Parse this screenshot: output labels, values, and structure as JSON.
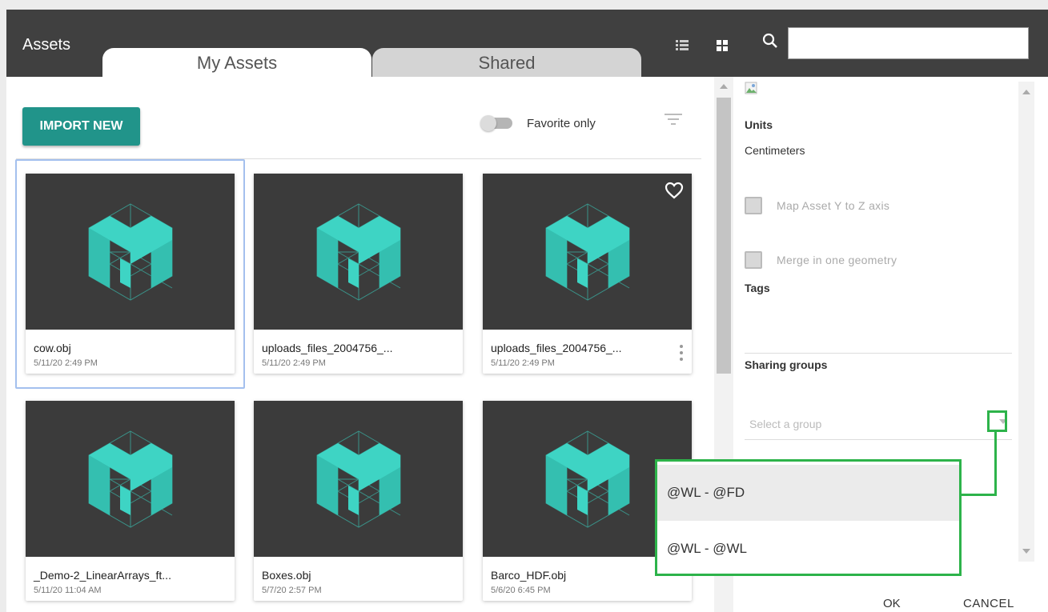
{
  "header": {
    "title": "Assets",
    "tabs": [
      {
        "label": "My Assets",
        "active": true
      },
      {
        "label": "Shared",
        "active": false
      }
    ],
    "list_view_icon": "list-icon",
    "grid_view_icon": "grid-icon",
    "search_icon": "search-icon",
    "search_value": ""
  },
  "toolbar": {
    "import_label": "IMPORT NEW",
    "favorite_label": "Favorite only",
    "filter_icon": "filter-icon"
  },
  "assets": [
    {
      "name": "cow.obj",
      "date": "5/11/20 2:49 PM",
      "selected": true,
      "favorite": false,
      "menu": false
    },
    {
      "name": "uploads_files_2004756_...",
      "date": "5/11/20 2:49 PM",
      "selected": false,
      "favorite": false,
      "menu": false
    },
    {
      "name": "uploads_files_2004756_...",
      "date": "5/11/20 2:49 PM",
      "selected": false,
      "favorite": true,
      "menu": true
    },
    {
      "name": "_Demo-2_LinearArrays_ft...",
      "date": "5/11/20 11:04 AM",
      "selected": false,
      "favorite": false,
      "menu": false
    },
    {
      "name": "Boxes.obj",
      "date": "5/7/20 2:57 PM",
      "selected": false,
      "favorite": false,
      "menu": false
    },
    {
      "name": "Barco_HDF.obj",
      "date": "5/6/20 6:45 PM",
      "selected": false,
      "favorite": false,
      "menu": false
    }
  ],
  "details": {
    "units_label": "Units",
    "units_value": "Centimeters",
    "map_axis_label": "Map Asset Y to Z axis",
    "merge_label": "Merge in one geometry",
    "tags_label": "Tags",
    "sharing_label": "Sharing groups",
    "group_placeholder": "Select a group",
    "ok_label": "OK",
    "cancel_label": "CANCEL"
  },
  "group_options": [
    "@WL - @FD",
    "@WL - @WL"
  ],
  "colors": {
    "header_bg": "#404040",
    "accent": "#21948a",
    "logo_teal": "#3ed4c4",
    "highlight": "#2db34a"
  }
}
